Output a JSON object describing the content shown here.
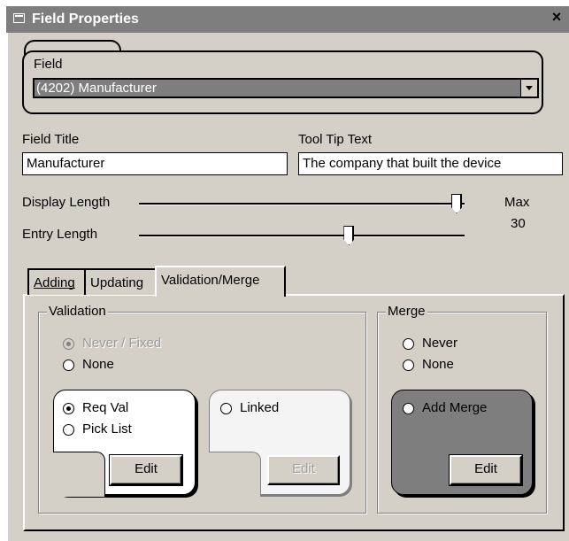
{
  "window": {
    "title": "Field Properties",
    "close_glyph": "×",
    "title_icon": "window-icon"
  },
  "field": {
    "group_label": "Field",
    "selected": "(4202) Manufacturer"
  },
  "field_title": {
    "label": "Field Title",
    "value": "Manufacturer"
  },
  "tooltip": {
    "label": "Tool Tip Text",
    "value": "The company that built the device"
  },
  "sliders": {
    "display_label": "Display Length",
    "entry_label": "Entry Length",
    "max_label": "Max",
    "max_value": "30",
    "display_fraction": 1.0,
    "entry_fraction": 0.65
  },
  "tabs": [
    {
      "label": "Adding",
      "active": false
    },
    {
      "label": "Updating",
      "active": false
    },
    {
      "label": "Validation/Merge",
      "active": true
    }
  ],
  "validation": {
    "title": "Validation",
    "never_fixed": "Never / Fixed",
    "none": "None",
    "req_val": "Req Val",
    "pick_list": "Pick List",
    "linked": "Linked",
    "edit1": "Edit",
    "edit2": "Edit"
  },
  "merge": {
    "title": "Merge",
    "never": "Never",
    "none": "None",
    "add_merge": "Add Merge",
    "edit": "Edit"
  }
}
